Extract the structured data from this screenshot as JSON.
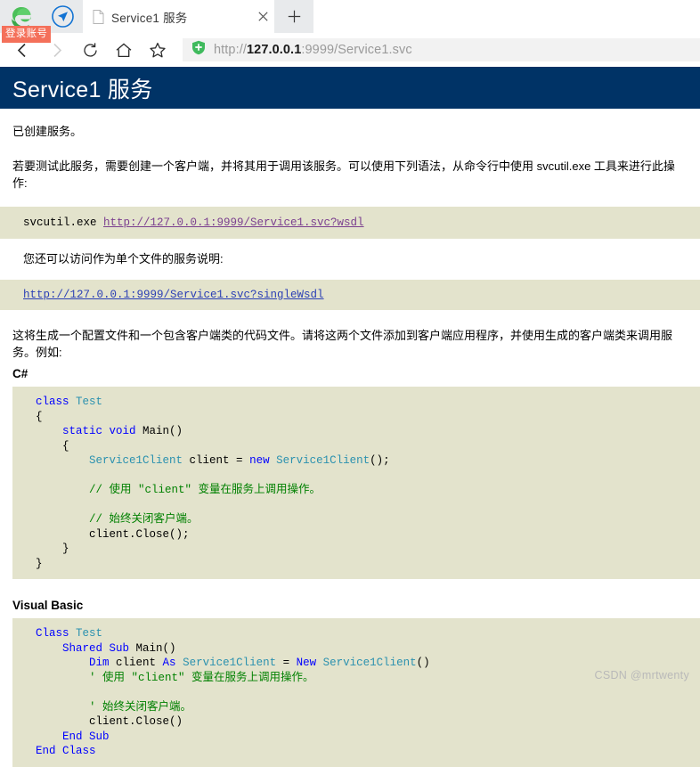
{
  "browser": {
    "account_badge": "登录账号",
    "icons": {
      "ie_logo": "edge-logo-icon",
      "pin": "pin-compass-icon",
      "tab_page": "page-icon",
      "tab_close": "close-icon",
      "new_tab": "new-tab-icon",
      "back": "back-arrow-icon",
      "forward": "forward-arrow-icon",
      "reload": "reload-icon",
      "home": "home-icon",
      "favorite": "star-icon",
      "shield": "shield-icon"
    },
    "tab": {
      "title": "Service1 服务",
      "close_label": "✕"
    },
    "new_tab_label": "+",
    "address": {
      "scheme": "http://",
      "host": "127.0.0.1",
      "rest": ":9999/Service1.svc",
      "full": "http://127.0.0.1:9999/Service1.svc"
    }
  },
  "page": {
    "banner_title": "Service1 服务",
    "banner_color": "#003366",
    "code_bg_color": "#e3e3cc",
    "created_text": "已创建服务。",
    "howto_text": "若要测试此服务，需要创建一个客户端，并将其用于调用该服务。可以使用下列语法，从命令行中使用 svcutil.exe 工具来进行此操作:",
    "svcutil_prefix": "svcutil.exe ",
    "svcutil_link": "http://127.0.0.1:9999/Service1.svc?wsdl",
    "single_file_text": "您还可以访问作为单个文件的服务说明:",
    "single_wsdl_link": "http://127.0.0.1:9999/Service1.svc?singleWsdl",
    "generate_text": "这将生成一个配置文件和一个包含客户端类的代码文件。请将这两个文件添加到客户端应用程序，并使用生成的客户端类来调用服务。例如:",
    "csharp": {
      "title": "C#",
      "lines": [
        [
          {
            "t": "class ",
            "c": "kw"
          },
          {
            "t": "Test",
            "c": "typ"
          }
        ],
        [
          {
            "t": "{",
            "c": ""
          }
        ],
        [
          {
            "t": "    ",
            "c": ""
          },
          {
            "t": "static void ",
            "c": "kw"
          },
          {
            "t": "Main()",
            "c": ""
          }
        ],
        [
          {
            "t": "    {",
            "c": ""
          }
        ],
        [
          {
            "t": "        ",
            "c": ""
          },
          {
            "t": "Service1Client",
            "c": "typ"
          },
          {
            "t": " client = ",
            "c": ""
          },
          {
            "t": "new ",
            "c": "kw"
          },
          {
            "t": "Service1Client",
            "c": "typ"
          },
          {
            "t": "();",
            "c": ""
          }
        ],
        [
          {
            "t": "",
            "c": ""
          }
        ],
        [
          {
            "t": "        ",
            "c": ""
          },
          {
            "t": "// 使用 \"client\" 变量在服务上调用操作。",
            "c": "cmt"
          }
        ],
        [
          {
            "t": "",
            "c": ""
          }
        ],
        [
          {
            "t": "        ",
            "c": ""
          },
          {
            "t": "// 始终关闭客户端。",
            "c": "cmt"
          }
        ],
        [
          {
            "t": "        client.Close();",
            "c": ""
          }
        ],
        [
          {
            "t": "    }",
            "c": ""
          }
        ],
        [
          {
            "t": "}",
            "c": ""
          }
        ]
      ]
    },
    "vb": {
      "title": "Visual Basic",
      "lines": [
        [
          {
            "t": "Class ",
            "c": "kw"
          },
          {
            "t": "Test",
            "c": "typ"
          }
        ],
        [
          {
            "t": "    ",
            "c": ""
          },
          {
            "t": "Shared Sub ",
            "c": "kw"
          },
          {
            "t": "Main()",
            "c": ""
          }
        ],
        [
          {
            "t": "        ",
            "c": ""
          },
          {
            "t": "Dim ",
            "c": "kw"
          },
          {
            "t": "client ",
            "c": ""
          },
          {
            "t": "As ",
            "c": "kw"
          },
          {
            "t": "Service1Client",
            "c": "typ"
          },
          {
            "t": " = ",
            "c": ""
          },
          {
            "t": "New ",
            "c": "kw"
          },
          {
            "t": "Service1Client",
            "c": "typ"
          },
          {
            "t": "()",
            "c": ""
          }
        ],
        [
          {
            "t": "        ",
            "c": ""
          },
          {
            "t": "' 使用 \"client\" 变量在服务上调用操作。",
            "c": "cmt"
          }
        ],
        [
          {
            "t": "",
            "c": ""
          }
        ],
        [
          {
            "t": "        ",
            "c": ""
          },
          {
            "t": "' 始终关闭客户端。",
            "c": "cmt"
          }
        ],
        [
          {
            "t": "        client.Close()",
            "c": ""
          }
        ],
        [
          {
            "t": "    ",
            "c": ""
          },
          {
            "t": "End Sub",
            "c": "kw"
          }
        ],
        [
          {
            "t": "",
            "c": "kw"
          },
          {
            "t": "End Class",
            "c": "kw"
          }
        ]
      ]
    }
  },
  "watermark": "CSDN @mrtwenty"
}
